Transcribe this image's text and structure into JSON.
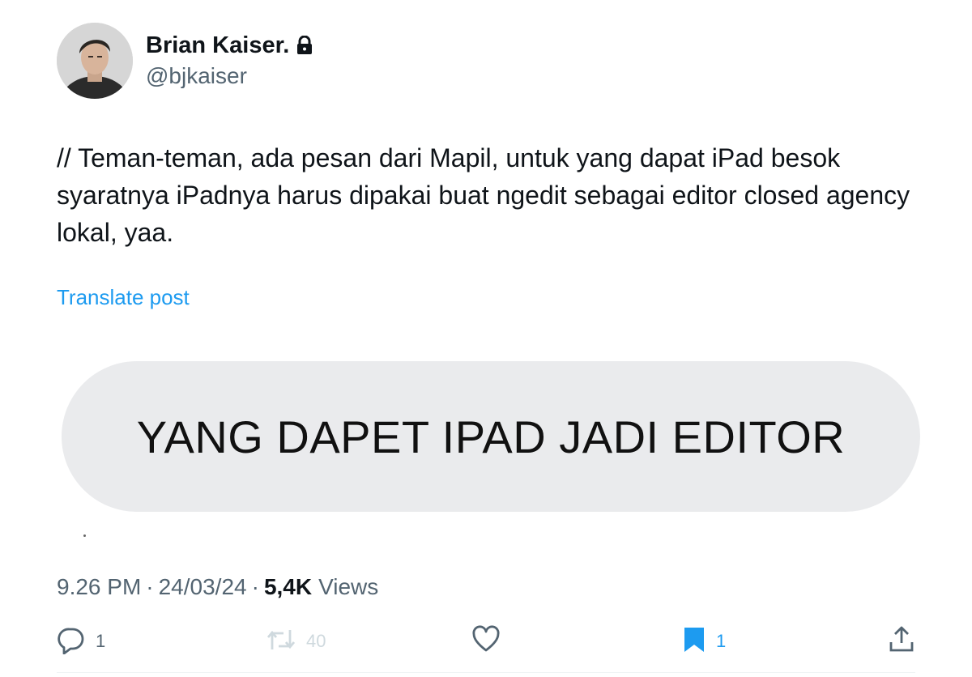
{
  "author": {
    "display_name": "Brian Kaiser.",
    "handle": "@bjkaiser",
    "protected_icon": "lock-icon"
  },
  "post": {
    "text": "// Teman-teman, ada pesan dari Mapil, untuk yang dapat iPad besok syaratnya iPadnya harus dipakai buat ngedit sebagai editor closed agency lokal, yaa.",
    "translate_label": "Translate post",
    "media_text": "YANG DAPET IPAD JADI EDITOR"
  },
  "meta": {
    "time": "9.26 PM",
    "date": "24/03/24",
    "separator": "·",
    "views_count": "5,4K",
    "views_label": "Views"
  },
  "actions": {
    "reply": {
      "icon": "reply-icon",
      "count": "1"
    },
    "repost": {
      "icon": "repost-icon",
      "count": "40",
      "color": "#cfd9de"
    },
    "like": {
      "icon": "heart-icon",
      "count": ""
    },
    "bookmark": {
      "icon": "bookmark-icon",
      "count": "1",
      "color": "#1d9bf0"
    },
    "share": {
      "icon": "share-icon"
    }
  },
  "colors": {
    "link": "#1d9bf0",
    "secondary_text": "#536471",
    "primary_text": "#0f1419",
    "media_background": "#eaebed"
  }
}
